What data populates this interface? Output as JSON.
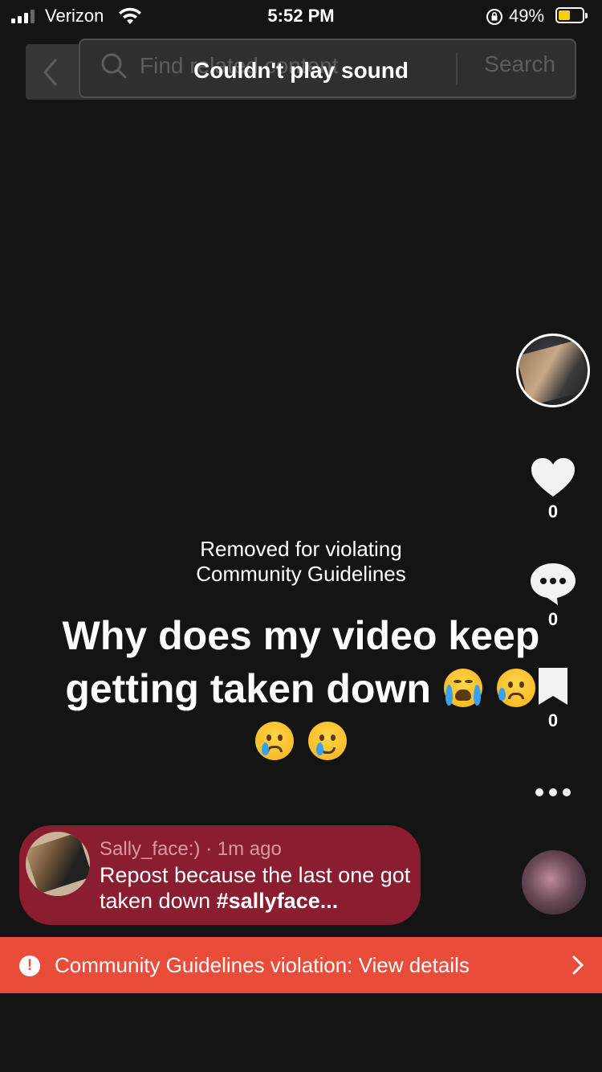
{
  "status_bar": {
    "carrier": "Verizon",
    "time": "5:52 PM",
    "battery_percent": "49%",
    "battery_level": 0.49
  },
  "search": {
    "placeholder": "Find related content",
    "button_label": "Search"
  },
  "toast": {
    "message": "Couldn't play sound"
  },
  "right_rail": {
    "like_count": "0",
    "comment_count": "0",
    "bookmark_count": "0"
  },
  "video": {
    "removed_line1": "Removed for violating",
    "removed_line2": "Community Guidelines",
    "caption_line1": "Why does my video keep",
    "caption_line2": "getting taken down"
  },
  "post": {
    "username": "Sally_face:)",
    "time_ago": "1m ago",
    "text": "Repost because the last one got taken down",
    "hashtag": "#sallyface..."
  },
  "violation_banner": {
    "label": "Community Guidelines violation: View details",
    "accent": "#ea4c3a"
  }
}
